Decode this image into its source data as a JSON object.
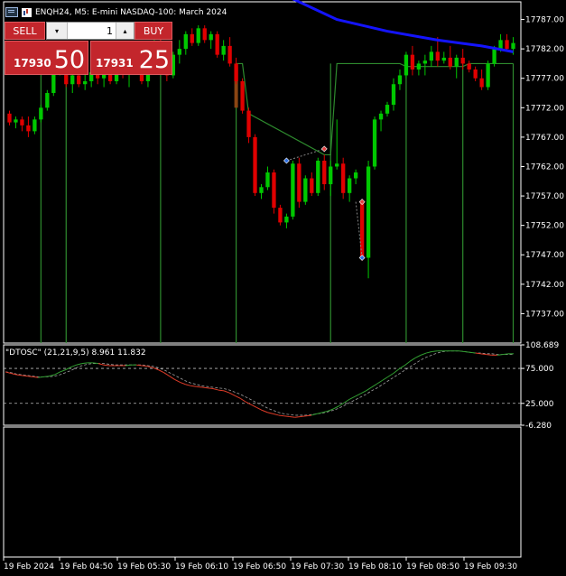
{
  "header": {
    "symbol_line": "ENQH24, M5:  E-mini NASDAQ-100: March 2024"
  },
  "trade_panel": {
    "sell_label": "SELL",
    "buy_label": "BUY",
    "volume": "1",
    "bid_prefix": "17930",
    "bid_big": "50",
    "ask_prefix": "17931",
    "ask_big": "25"
  },
  "colors": {
    "bull": "#00c800",
    "bear": "#e00000",
    "ma_line": "#1414ff",
    "signal_line": "#2e8b2e",
    "brown": "#8b4513",
    "osc_fast": "#e03c28",
    "osc_slow": "#a0a0a0",
    "osc_green": "#32a032"
  },
  "chart_data": [
    {
      "type": "candlestick",
      "title": "ENQH24, M5:  E-mini NASDAQ-100: March 2024",
      "ylim": [
        17732,
        17790
      ],
      "y_ticks": [
        "17787.00",
        "17782.00",
        "17777.00",
        "17772.00",
        "17767.00",
        "17762.00",
        "17757.00",
        "17752.00",
        "17747.00",
        "17742.00",
        "17737.00"
      ],
      "grid": false,
      "candles": [
        [
          17771.0,
          17771.5,
          17769.0,
          17769.5
        ],
        [
          17769.5,
          17770.5,
          17768.5,
          17770.0
        ],
        [
          17770.0,
          17770.5,
          17768.0,
          17769.0
        ],
        [
          17769.0,
          17770.5,
          17767.0,
          17768.0
        ],
        [
          17768.0,
          17770.5,
          17767.5,
          17770.0
        ],
        [
          17770.0,
          17772.5,
          17769.5,
          17772.0
        ],
        [
          17772.0,
          17775.0,
          17771.5,
          17774.5
        ],
        [
          17774.5,
          17779.0,
          17774.0,
          17778.5
        ],
        [
          17778.5,
          17781.5,
          17777.5,
          17779.0
        ],
        [
          17779.0,
          17779.5,
          17775.5,
          17776.0
        ],
        [
          17776.0,
          17778.0,
          17774.5,
          17777.5
        ],
        [
          17777.5,
          17779.0,
          17775.5,
          17776.0
        ],
        [
          17776.0,
          17779.0,
          17775.0,
          17776.5
        ],
        [
          17776.5,
          17778.5,
          17775.5,
          17778.0
        ],
        [
          17778.0,
          17780.5,
          17776.0,
          17777.0
        ],
        [
          17777.0,
          17779.0,
          17775.5,
          17778.5
        ],
        [
          17778.5,
          17779.0,
          17776.0,
          17776.5
        ],
        [
          17776.5,
          17779.5,
          17776.0,
          17779.0
        ],
        [
          17779.0,
          17781.5,
          17777.0,
          17778.0
        ],
        [
          17778.0,
          17780.5,
          17775.5,
          17780.0
        ],
        [
          17780.0,
          17782.0,
          17778.5,
          17779.0
        ],
        [
          17779.0,
          17779.5,
          17776.0,
          17776.5
        ],
        [
          17776.5,
          17779.5,
          17775.5,
          17779.0
        ],
        [
          17779.0,
          17783.5,
          17778.5,
          17783.0
        ],
        [
          17783.0,
          17784.5,
          17779.0,
          17779.5
        ],
        [
          17779.5,
          17780.5,
          17776.5,
          17777.5
        ],
        [
          17777.5,
          17781.5,
          17777.0,
          17781.0
        ],
        [
          17781.0,
          17783.5,
          17779.5,
          17782.0
        ],
        [
          17782.0,
          17785.0,
          17781.0,
          17784.5
        ],
        [
          17784.5,
          17785.5,
          17782.5,
          17783.0
        ],
        [
          17783.0,
          17786.0,
          17782.5,
          17785.5
        ],
        [
          17785.5,
          17786.0,
          17783.0,
          17783.5
        ],
        [
          17783.5,
          17785.0,
          17782.0,
          17784.5
        ],
        [
          17784.5,
          17785.0,
          17780.5,
          17781.0
        ],
        [
          17781.0,
          17783.5,
          17780.0,
          17782.5
        ],
        [
          17782.5,
          17784.0,
          17779.0,
          17779.5
        ],
        [
          17779.5,
          17780.5,
          17776.0,
          17776.5
        ],
        [
          17776.5,
          17777.0,
          17771.0,
          17771.5
        ],
        [
          17771.5,
          17772.0,
          17766.0,
          17767.0
        ],
        [
          17767.0,
          17767.5,
          17757.0,
          17757.5
        ],
        [
          17757.5,
          17759.0,
          17756.5,
          17758.5
        ],
        [
          17758.5,
          17762.0,
          17758.0,
          17761.0
        ],
        [
          17761.0,
          17761.5,
          17754.0,
          17755.0
        ],
        [
          17755.0,
          17755.5,
          17752.0,
          17752.5
        ],
        [
          17752.5,
          17754.0,
          17751.5,
          17753.5
        ],
        [
          17753.5,
          17763.0,
          17753.0,
          17762.5
        ],
        [
          17762.5,
          17763.5,
          17755.0,
          17756.0
        ],
        [
          17756.0,
          17760.5,
          17755.5,
          17760.0
        ],
        [
          17760.0,
          17761.0,
          17757.0,
          17757.5
        ],
        [
          17757.5,
          17763.5,
          17757.0,
          17763.0
        ],
        [
          17763.0,
          17764.0,
          17758.0,
          17759.0
        ],
        [
          17759.0,
          17763.0,
          17757.0,
          17762.0
        ],
        [
          17762.0,
          17770.0,
          17761.5,
          17762.5
        ],
        [
          17762.5,
          17763.5,
          17756.5,
          17757.5
        ],
        [
          17757.5,
          17760.5,
          17756.0,
          17760.0
        ],
        [
          17760.0,
          17761.5,
          17759.0,
          17761.0
        ],
        [
          17756.0,
          17756.5,
          17746.0,
          17746.5
        ],
        [
          17746.5,
          17763.0,
          17743.0,
          17762.0
        ],
        [
          17762.0,
          17770.5,
          17761.5,
          17770.0
        ],
        [
          17770.0,
          17771.5,
          17768.0,
          17771.0
        ],
        [
          17771.0,
          17773.0,
          17770.5,
          17772.5
        ],
        [
          17772.5,
          17777.0,
          17771.5,
          17776.0
        ],
        [
          17776.0,
          17778.5,
          17775.0,
          17777.5
        ],
        [
          17777.5,
          17781.5,
          17777.0,
          17781.0
        ],
        [
          17781.0,
          17782.5,
          17777.5,
          17778.5
        ],
        [
          17778.5,
          17780.0,
          17777.5,
          17779.5
        ],
        [
          17779.5,
          17781.0,
          17777.5,
          17780.0
        ],
        [
          17780.0,
          17782.5,
          17779.0,
          17781.5
        ],
        [
          17781.5,
          17784.0,
          17779.0,
          17780.0
        ],
        [
          17780.0,
          17781.5,
          17779.5,
          17780.5
        ],
        [
          17780.5,
          17782.5,
          17778.5,
          17779.0
        ],
        [
          17779.0,
          17781.0,
          17777.0,
          17780.5
        ],
        [
          17780.5,
          17782.0,
          17778.5,
          17779.5
        ],
        [
          17779.5,
          17780.0,
          17778.0,
          17778.5
        ],
        [
          17778.5,
          17779.0,
          17776.5,
          17777.0
        ],
        [
          17777.0,
          17778.5,
          17775.0,
          17775.5
        ],
        [
          17775.5,
          17780.0,
          17775.0,
          17779.5
        ],
        [
          17779.5,
          17782.5,
          17779.0,
          17782.0
        ],
        [
          17782.0,
          17784.5,
          17781.5,
          17783.5
        ],
        [
          17783.5,
          17784.5,
          17781.5,
          17782.0
        ],
        [
          17782.0,
          17784.0,
          17781.0,
          17783.0
        ]
      ]
    },
    {
      "type": "line",
      "title": "\"DTOSC\" (21,21,9,5) 8.961 11.832",
      "ylim": [
        -6.28,
        108.689
      ],
      "y_ticks": [
        "108.689",
        "75.000",
        "25.000",
        "-6.280"
      ],
      "levels": [
        75,
        25
      ],
      "series": [
        {
          "name": "fast",
          "values": [
            70,
            68,
            66,
            65,
            64,
            63,
            62,
            63,
            64,
            66,
            70,
            73,
            77,
            80,
            82,
            83,
            83,
            82,
            80,
            79,
            79,
            79,
            79,
            80,
            80,
            79,
            78,
            76,
            73,
            69,
            64,
            59,
            55,
            52,
            50,
            49,
            48,
            47,
            46,
            44,
            43,
            40,
            36,
            32,
            27,
            23,
            19,
            15,
            12,
            10,
            8,
            7,
            6,
            5,
            6,
            7,
            8,
            10,
            12,
            14,
            17,
            21,
            26,
            31,
            35,
            39,
            43,
            48,
            53,
            58,
            63,
            68,
            74,
            79,
            85,
            90,
            94,
            97,
            99,
            100,
            100,
            100,
            100,
            100,
            99,
            98,
            97,
            96,
            95,
            94,
            94,
            95,
            96,
            96
          ]
        },
        {
          "name": "slow",
          "values": [
            70,
            69,
            67,
            66,
            65,
            64,
            63,
            63,
            63,
            64,
            66,
            69,
            72,
            76,
            79,
            81,
            82,
            82,
            82,
            81,
            80,
            80,
            80,
            80,
            80,
            80,
            79,
            78,
            76,
            73,
            69,
            65,
            61,
            57,
            54,
            52,
            50,
            49,
            48,
            47,
            46,
            44,
            41,
            38,
            34,
            30,
            26,
            22,
            18,
            15,
            12,
            10,
            9,
            8,
            8,
            8,
            9,
            10,
            11,
            13,
            15,
            18,
            22,
            26,
            30,
            34,
            38,
            43,
            47,
            52,
            57,
            62,
            67,
            72,
            77,
            82,
            87,
            91,
            94,
            97,
            99,
            100,
            100,
            100,
            99,
            98,
            97,
            97,
            96,
            96,
            95,
            95,
            95,
            95
          ]
        }
      ]
    }
  ],
  "x_axis_labels": [
    "19 Feb 2024",
    "19 Feb 04:50",
    "19 Feb 05:30",
    "19 Feb 06:10",
    "19 Feb 06:50",
    "19 Feb 07:30",
    "19 Feb 08:10",
    "19 Feb 08:50",
    "19 Feb 09:30"
  ]
}
